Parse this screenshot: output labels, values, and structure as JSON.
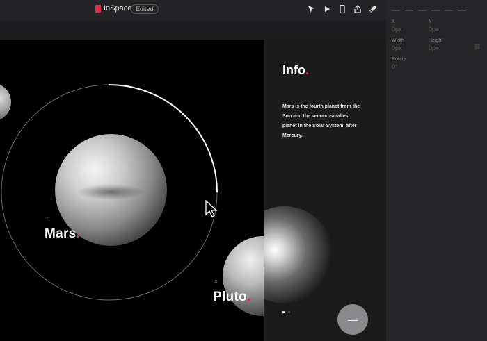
{
  "document": {
    "name": "InSpace",
    "status": "Edited"
  },
  "toolbar": {
    "icons": [
      "select-tool-icon",
      "play-icon",
      "phone-preview-icon",
      "share-icon",
      "rocket-icon",
      "more-icon"
    ]
  },
  "canvas": {
    "planets": [
      {
        "index": "02",
        "name": "Mars"
      },
      {
        "index": "03",
        "name": "Pluto"
      }
    ],
    "info": {
      "title": "Info",
      "text": "Mars is the fourth planet from the Sun and the second-smallest planet in the Solar System, after Mercury."
    },
    "fab_label": "—"
  },
  "inspector": {
    "x_label": "X",
    "x_value": "0px",
    "y_label": "Y",
    "y_value": "0px",
    "width_label": "Width",
    "width_value": "0px",
    "height_label": "Height",
    "height_value": "0px",
    "rotate_label": "Rotate",
    "rotate_value": "0°"
  },
  "colors": {
    "accent": "#e8294a",
    "canvas": "#000000",
    "panel": "#252527"
  }
}
